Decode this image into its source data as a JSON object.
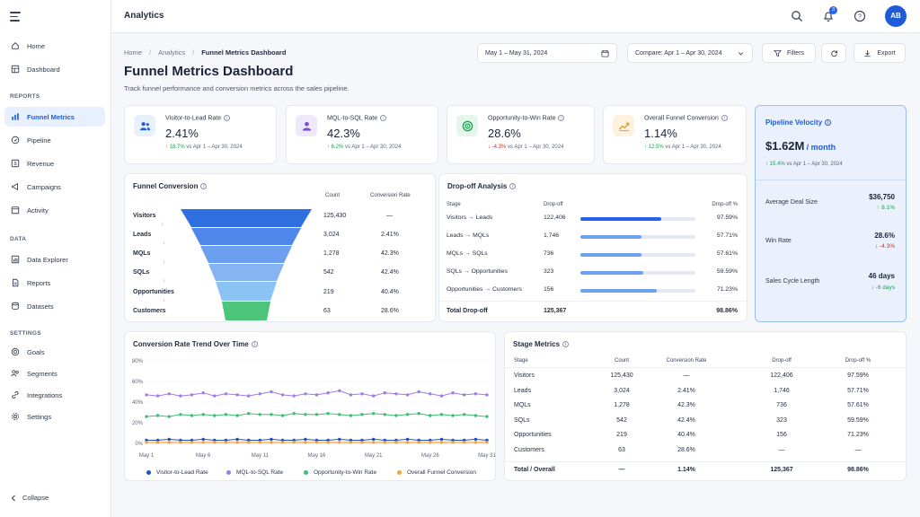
{
  "app": {
    "title": "Analytics",
    "notification_count": "3",
    "avatar_initials": "AB"
  },
  "sidebar": {
    "items_top": [
      {
        "label": "Home",
        "icon": "home-icon"
      },
      {
        "label": "Dashboard",
        "icon": "dashboard-icon"
      }
    ],
    "sections": [
      {
        "title": "REPORTS",
        "items": [
          {
            "label": "Funnel Metrics",
            "icon": "bar-chart-icon",
            "active": true
          },
          {
            "label": "Pipeline",
            "icon": "pipeline-icon"
          },
          {
            "label": "Revenue",
            "icon": "dollar-icon"
          },
          {
            "label": "Campaigns",
            "icon": "megaphone-icon"
          },
          {
            "label": "Activity",
            "icon": "activity-icon"
          }
        ]
      },
      {
        "title": "DATA",
        "items": [
          {
            "label": "Data Explorer",
            "icon": "chart-explore-icon"
          },
          {
            "label": "Reports",
            "icon": "document-icon"
          },
          {
            "label": "Datasets",
            "icon": "database-icon"
          }
        ]
      },
      {
        "title": "SETTINGS",
        "items": [
          {
            "label": "Goals",
            "icon": "target-icon"
          },
          {
            "label": "Segments",
            "icon": "segments-icon"
          },
          {
            "label": "Integrations",
            "icon": "link-icon"
          },
          {
            "label": "Settings",
            "icon": "gear-icon"
          }
        ]
      }
    ],
    "collapse_label": "Collapse"
  },
  "breadcrumb": [
    "Home",
    "Analytics",
    "Funnel Metrics Dashboard"
  ],
  "page": {
    "title": "Funnel Metrics Dashboard",
    "subtitle": "Track funnel performance and conversion metrics across the sales pipeline."
  },
  "controls": {
    "date_range": "May 1 – May 31, 2024",
    "compare": "Compare: Apr 1 – Apr 30, 2024",
    "filters": "Filters",
    "export": "Export"
  },
  "kpis": [
    {
      "label": "Visitor-to-Lead Rate",
      "value": "2.41%",
      "delta": "18.7%",
      "direction": "up",
      "compare": "vs Apr 1 – Apr 30, 2024",
      "icon": "users-icon",
      "color": "#1d5bd8",
      "bg": "#e8effd"
    },
    {
      "label": "MQL-to-SQL Rate",
      "value": "42.3%",
      "delta": "6.2%",
      "direction": "up",
      "compare": "vs Apr 1 – Apr 30, 2024",
      "icon": "user-icon",
      "color": "#7c4ddb",
      "bg": "#efe8fb"
    },
    {
      "label": "Opportunity-to-Win Rate",
      "value": "28.6%",
      "delta": "-4.3%",
      "direction": "down",
      "compare": "vs Apr 1 – Apr 30, 2024",
      "icon": "target-icon",
      "color": "#16a34a",
      "bg": "#e5f6ea"
    },
    {
      "label": "Overall Funnel Conversion",
      "value": "1.14%",
      "delta": "12.5%",
      "direction": "up",
      "compare": "vs Apr 1 – Apr 30, 2024",
      "icon": "trend-up-icon",
      "color": "#e59a1a",
      "bg": "#fdf2e0"
    }
  ],
  "velocity": {
    "title": "Pipeline Velocity",
    "value": "$1.62M",
    "unit": "/ month",
    "delta": "15.4%",
    "compare": "vs Apr 1 – Apr 30, 2024",
    "metrics": [
      {
        "label": "Average Deal Size",
        "value": "$36,750",
        "delta": "8.1%",
        "direction": "up"
      },
      {
        "label": "Win Rate",
        "value": "28.6%",
        "delta": "-4.3%",
        "direction": "down"
      },
      {
        "label": "Sales Cycle Length",
        "value": "46 days",
        "delta": "-6 days",
        "direction": "up"
      }
    ]
  },
  "funnel": {
    "title": "Funnel Conversion",
    "col_count": "Count",
    "col_rate": "Conversion Rate",
    "stages": [
      {
        "label": "Visitors",
        "count": "125,430",
        "rate": "—",
        "color": "#2f6fe0"
      },
      {
        "label": "Leads",
        "count": "3,024",
        "rate": "2.41%",
        "color": "#4e86ea"
      },
      {
        "label": "MQLs",
        "count": "1,278",
        "rate": "42.3%",
        "color": "#6d9ff0"
      },
      {
        "label": "SQLs",
        "count": "542",
        "rate": "42.4%",
        "color": "#86b4f3"
      },
      {
        "label": "Opportunities",
        "count": "219",
        "rate": "40.4%",
        "color": "#8cc3f5"
      },
      {
        "label": "Customers",
        "count": "63",
        "rate": "28.6%",
        "color": "#4cc57a"
      }
    ]
  },
  "dropoff": {
    "title": "Drop-off Analysis",
    "col_stage": "Stage",
    "col_dropoff": "Drop-off",
    "col_pct": "Drop-off %",
    "rows": [
      {
        "stage": "Visitors → Leads",
        "dropoff": "122,406",
        "pct": "97.59%",
        "fraction": 0.7
      },
      {
        "stage": "Leads → MQLs",
        "dropoff": "1,746",
        "pct": "57.71%",
        "fraction": 0.53
      },
      {
        "stage": "MQLs → SQLs",
        "dropoff": "736",
        "pct": "57.61%",
        "fraction": 0.53
      },
      {
        "stage": "SQLs → Opportunities",
        "dropoff": "323",
        "pct": "59.59%",
        "fraction": 0.55
      },
      {
        "stage": "Opportunities → Customers",
        "dropoff": "156",
        "pct": "71.23%",
        "fraction": 0.66
      }
    ],
    "total_label": "Total Drop-off",
    "total_dropoff": "125,367",
    "total_pct": "98.86%"
  },
  "chart_data": {
    "type": "line",
    "title": "Conversion Rate Trend Over Time",
    "ylim": [
      0,
      80
    ],
    "y_ticks": [
      "0%",
      "20%",
      "40%",
      "60%",
      "80%"
    ],
    "x_tick_labels": [
      "May 1",
      "May 6",
      "May 11",
      "May 16",
      "May 21",
      "May 26",
      "May 31"
    ],
    "x": [
      1,
      2,
      3,
      4,
      5,
      6,
      7,
      8,
      9,
      10,
      11,
      12,
      13,
      14,
      15,
      16,
      17,
      18,
      19,
      20,
      21,
      22,
      23,
      24,
      25,
      26,
      27,
      28,
      29,
      30,
      31
    ],
    "grid": true,
    "legend_position": "bottom",
    "series": [
      {
        "name": "Visitor-to-Lead Rate",
        "color": "#1d4fc4",
        "values": [
          3,
          3,
          4,
          3,
          3,
          4,
          3,
          3,
          4,
          3,
          3,
          4,
          3,
          3,
          4,
          3,
          3,
          4,
          3,
          3,
          4,
          3,
          3,
          4,
          3,
          3,
          4,
          3,
          3,
          4,
          3
        ]
      },
      {
        "name": "MQL-to-SQL Rate",
        "color": "#9b7fe0",
        "values": [
          47,
          46,
          48,
          46,
          47,
          49,
          46,
          48,
          47,
          46,
          48,
          50,
          47,
          46,
          48,
          47,
          49,
          51,
          47,
          48,
          46,
          49,
          48,
          47,
          50,
          48,
          46,
          49,
          47,
          48,
          47
        ]
      },
      {
        "name": "Opportunity-to-Win Rate",
        "color": "#3cbf74",
        "values": [
          26,
          27,
          26,
          28,
          27,
          28,
          27,
          28,
          27,
          29,
          28,
          28,
          27,
          29,
          28,
          28,
          29,
          28,
          27,
          28,
          29,
          28,
          27,
          28,
          29,
          27,
          28,
          27,
          28,
          27,
          26
        ]
      },
      {
        "name": "Overall Funnel Conversion",
        "color": "#f0a43a",
        "values": [
          1,
          1,
          1,
          1,
          1,
          1,
          1,
          1,
          1,
          1,
          1,
          1,
          1,
          1,
          1,
          1,
          1,
          1,
          1,
          1,
          1,
          1,
          1,
          1,
          1,
          1,
          1,
          1,
          1,
          1,
          1
        ]
      }
    ]
  },
  "stage_metrics": {
    "title": "Stage Metrics",
    "columns": [
      "Stage",
      "Count",
      "Conversion Rate",
      "Drop-off",
      "Drop-off %"
    ],
    "rows": [
      [
        "Visitors",
        "125,430",
        "—",
        "122,406",
        "97.59%"
      ],
      [
        "Leads",
        "3,024",
        "2.41%",
        "1,746",
        "57.71%"
      ],
      [
        "MQLs",
        "1,278",
        "42.3%",
        "736",
        "57.61%"
      ],
      [
        "SQLs",
        "542",
        "42.4%",
        "323",
        "59.59%"
      ],
      [
        "Opportunities",
        "219",
        "40.4%",
        "156",
        "71.23%"
      ],
      [
        "Customers",
        "63",
        "28.6%",
        "—",
        "—"
      ]
    ],
    "total": [
      "Total / Overall",
      "—",
      "1.14%",
      "125,367",
      "98.86%"
    ]
  }
}
